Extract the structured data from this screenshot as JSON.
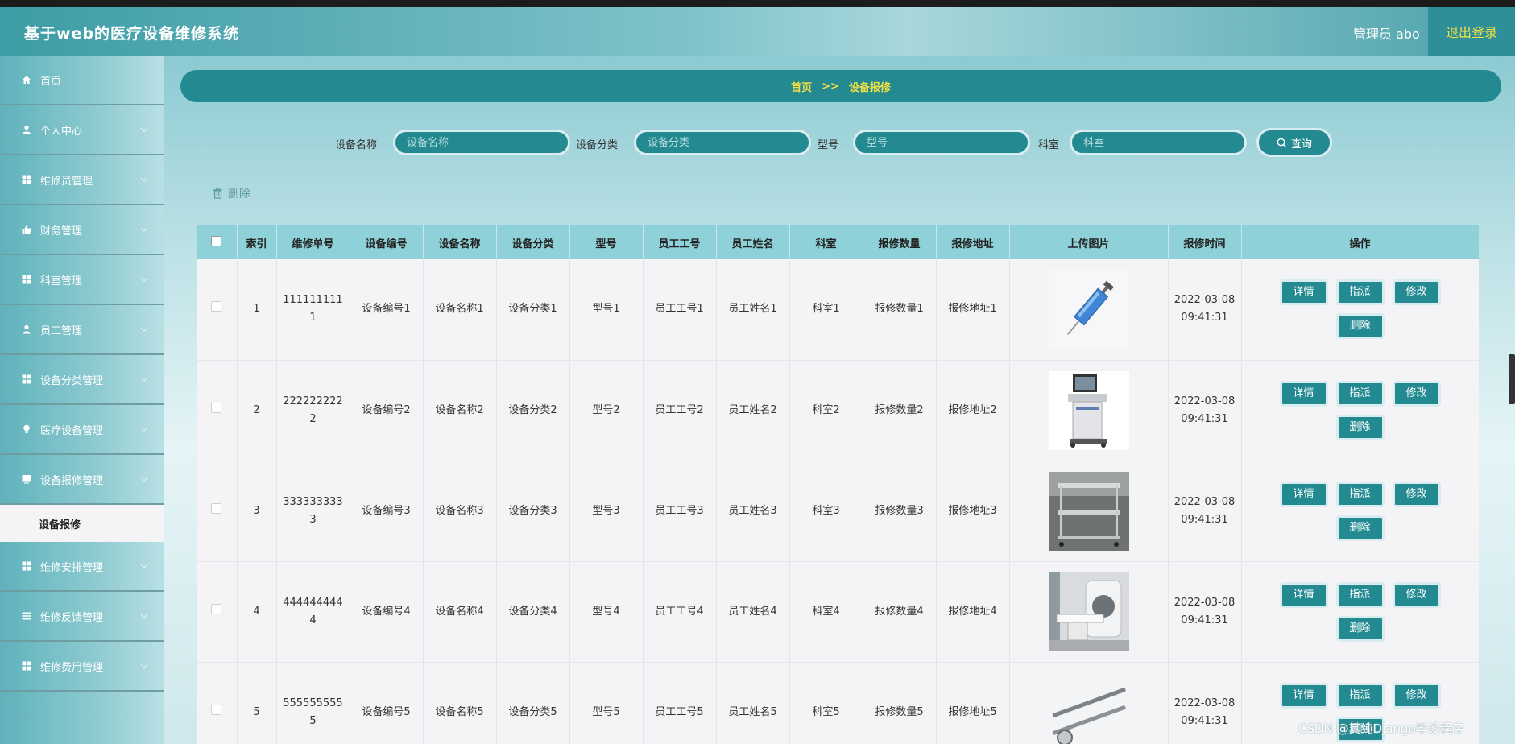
{
  "header": {
    "title": "基于web的医疗设备维修系统",
    "user": "管理员 abo",
    "logout": "退出登录"
  },
  "sidebar": {
    "items": [
      {
        "label": "首页",
        "icon": "home-icon"
      },
      {
        "label": "个人中心",
        "icon": "user-icon"
      },
      {
        "label": "维修员管理",
        "icon": "grid-icon"
      },
      {
        "label": "财务管理",
        "icon": "thumb-icon"
      },
      {
        "label": "科室管理",
        "icon": "grid-icon"
      },
      {
        "label": "员工管理",
        "icon": "user-icon"
      },
      {
        "label": "设备分类管理",
        "icon": "grid-icon"
      },
      {
        "label": "医疗设备管理",
        "icon": "bulb-icon"
      },
      {
        "label": "设备报修管理",
        "icon": "monitor-icon"
      },
      {
        "label": "维修安排管理",
        "icon": "grid-icon"
      },
      {
        "label": "维修反馈管理",
        "icon": "menu-icon"
      },
      {
        "label": "维修费用管理",
        "icon": "grid-icon"
      }
    ],
    "active_sub": "设备报修"
  },
  "breadcrumb": {
    "home": "首页",
    "sep": ">>",
    "current": "设备报修"
  },
  "search": {
    "fields": [
      {
        "label": "设备名称",
        "placeholder": "设备名称"
      },
      {
        "label": "设备分类",
        "placeholder": "设备分类"
      },
      {
        "label": "型号",
        "placeholder": "型号"
      },
      {
        "label": "科室",
        "placeholder": "科室"
      }
    ],
    "button": "查询"
  },
  "toolbar": {
    "delete": "删除"
  },
  "table": {
    "headers": [
      "索引",
      "维修单号",
      "设备编号",
      "设备名称",
      "设备分类",
      "型号",
      "员工工号",
      "员工姓名",
      "科室",
      "报修数量",
      "报修地址",
      "上传图片",
      "报修时间",
      "操作"
    ],
    "rows": [
      {
        "index": "1",
        "order": "1111111111",
        "code": "设备编号1",
        "name": "设备名称1",
        "category": "设备分类1",
        "model": "型号1",
        "emp_id": "员工工号1",
        "emp_name": "员工姓名1",
        "dept": "科室1",
        "qty": "报修数量1",
        "addr": "报修地址1",
        "image": "syringe",
        "time": "2022-03-08 09:41:31"
      },
      {
        "index": "2",
        "order": "2222222222",
        "code": "设备编号2",
        "name": "设备名称2",
        "category": "设备分类2",
        "model": "型号2",
        "emp_id": "员工工号2",
        "emp_name": "员工姓名2",
        "dept": "科室2",
        "qty": "报修数量2",
        "addr": "报修地址2",
        "image": "ultrasound",
        "time": "2022-03-08 09:41:31"
      },
      {
        "index": "3",
        "order": "3333333333",
        "code": "设备编号3",
        "name": "设备名称3",
        "category": "设备分类3",
        "model": "型号3",
        "emp_id": "员工工号3",
        "emp_name": "员工姓名3",
        "dept": "科室3",
        "qty": "报修数量3",
        "addr": "报修地址3",
        "image": "cart",
        "time": "2022-03-08 09:41:31"
      },
      {
        "index": "4",
        "order": "4444444444",
        "code": "设备编号4",
        "name": "设备名称4",
        "category": "设备分类4",
        "model": "型号4",
        "emp_id": "员工工号4",
        "emp_name": "员工姓名4",
        "dept": "科室4",
        "qty": "报修数量4",
        "addr": "报修地址4",
        "image": "ct-scanner",
        "time": "2022-03-08 09:41:31"
      },
      {
        "index": "5",
        "order": "5555555555",
        "code": "设备编号5",
        "name": "设备名称5",
        "category": "设备分类5",
        "model": "型号5",
        "emp_id": "员工工号5",
        "emp_name": "员工姓名5",
        "dept": "科室5",
        "qty": "报修数量5",
        "addr": "报修地址5",
        "image": "dental-tools",
        "time": "2022-03-08 09:41:31"
      }
    ],
    "ops": [
      "详情",
      "指派",
      "修改",
      "删除"
    ]
  },
  "watermark": "CSDN @其纯Django毕设程序"
}
